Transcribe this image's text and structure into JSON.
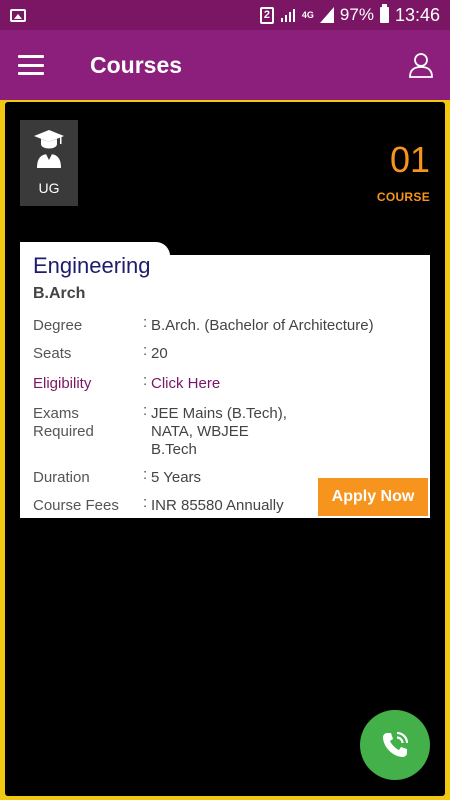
{
  "statusbar": {
    "sim": "2",
    "network": "4G",
    "battery": "97%",
    "time": "13:46"
  },
  "appbar": {
    "title": "Courses"
  },
  "panel": {
    "level_label": "UG",
    "count_value": "01",
    "count_label": "COURSE"
  },
  "course": {
    "category": "Engineering",
    "name": "B.Arch",
    "fields": [
      {
        "key": "Degree",
        "value": "B.Arch. (Bachelor of Architecture)"
      },
      {
        "key": "Seats",
        "value": "20"
      },
      {
        "key": "Eligibility",
        "value": "Click Here"
      },
      {
        "key": "Exams Required",
        "value": "JEE Mains (B.Tech), NATA, WBJEE B.Tech"
      },
      {
        "key": "Duration",
        "value": "5 Years"
      },
      {
        "key": "Course Fees",
        "value": "INR 85580 Annually"
      }
    ],
    "apply_label": "Apply Now"
  },
  "colors": {
    "primary": "#8d1f7c",
    "accent": "#f7941d",
    "fab": "#43b049",
    "title": "#1f1d6b"
  },
  "icons": {
    "menu": "menu-icon",
    "profile": "profile-icon",
    "graduate": "graduate-icon",
    "call": "phone-call-icon"
  }
}
